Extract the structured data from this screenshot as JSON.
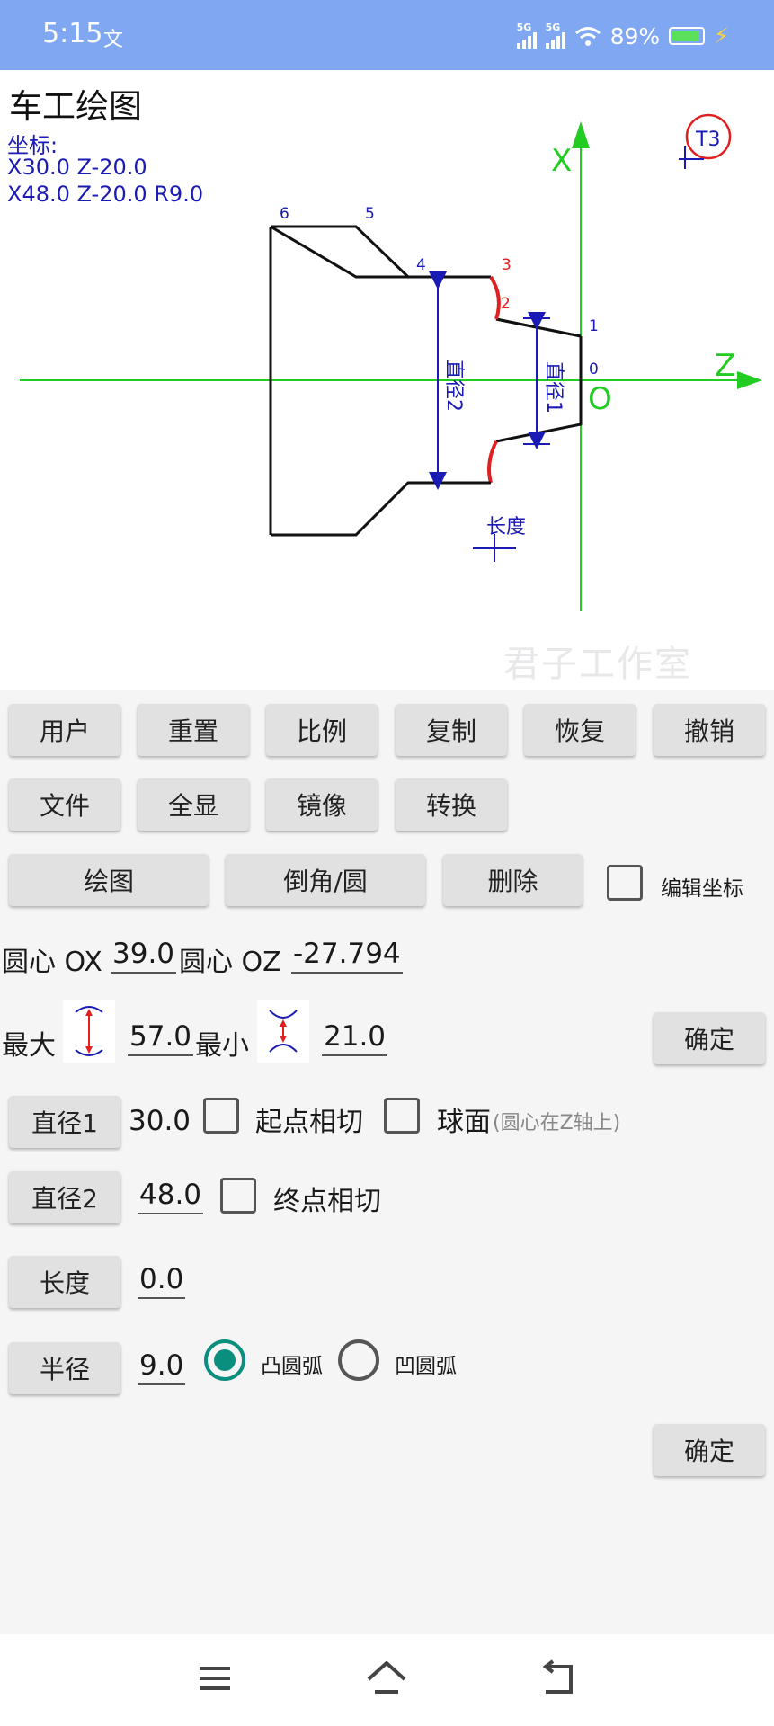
{
  "status_bar": {
    "time": "5:15",
    "carrier_icon": "文",
    "signal1": "5G",
    "signal2": "5G",
    "battery": "89%"
  },
  "drawing": {
    "title": "车工绘图",
    "coord_label": "坐标:",
    "coord_line1": "X30.0 Z-20.0",
    "coord_line2": "X48.0 Z-20.0 R9.0",
    "axis_x": "X",
    "axis_z": "Z",
    "origin": "O",
    "tool": "T3",
    "points": [
      "0",
      "1",
      "2",
      "3",
      "4",
      "5",
      "6"
    ],
    "dim_diameter1": "直径1",
    "dim_diameter2": "直径2",
    "dim_length": "长度",
    "watermark": "君子工作室"
  },
  "toolbar": {
    "row1": [
      "用户",
      "重置",
      "比例",
      "复制",
      "恢复",
      "撤销"
    ],
    "row2": [
      "文件",
      "全显",
      "镜像",
      "转换"
    ],
    "draw": "绘图",
    "chamfer": "倒角/圆",
    "delete": "删除",
    "edit_coords": "编辑坐标"
  },
  "form": {
    "center_ox_label": "圆心 OX",
    "center_ox_value": "39.0",
    "center_oz_label": "圆心 OZ",
    "center_oz_value": "-27.794",
    "max_label": "最大",
    "max_value": "57.0",
    "min_label": "最小",
    "min_value": "21.0",
    "confirm1": "确定",
    "diameter1_button": "直径1",
    "diameter1_value": "30.0",
    "start_tangent": "起点相切",
    "sphere": "球面",
    "sphere_hint": "(圆心在Z轴上)",
    "diameter2_button": "直径2",
    "diameter2_value": "48.0",
    "end_tangent": "终点相切",
    "length_button": "长度",
    "length_value": "0.0",
    "radius_button": "半径",
    "radius_value": "9.0",
    "convex_arc": "凸圆弧",
    "concave_arc": "凹圆弧",
    "convex_selected": true,
    "confirm2": "确定"
  },
  "colors": {
    "status_bar": "#7fa7f2",
    "axis": "#22cc22",
    "outline": "#111111",
    "dimension": "#1a1ab4",
    "arc": "#e02020",
    "radio_accent": "#0a8f7e"
  },
  "icons": {
    "nav_menu": "menu-icon",
    "nav_home": "home-icon",
    "nav_back": "back-icon",
    "max_icon": "max-diameter-icon",
    "min_icon": "min-diameter-icon"
  }
}
